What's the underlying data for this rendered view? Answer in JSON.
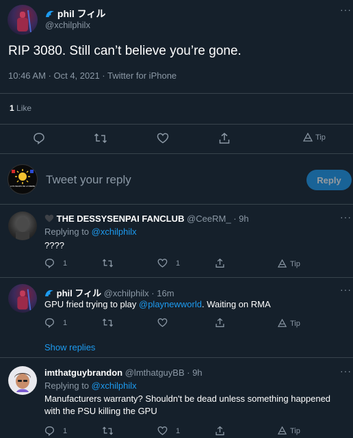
{
  "main_tweet": {
    "display_name": "phil フィル",
    "handle": "@xchilphilx",
    "text": "RIP 3080. Still can’t believe you’re gone.",
    "meta": "10:46 AM · Oct 4, 2021 · Twitter for iPhone",
    "likes_count": "1",
    "likes_label": "Like",
    "tip_label": "Tip"
  },
  "compose": {
    "placeholder": "Tweet your reply",
    "reply_button": "Reply",
    "avatar_text": "LOS DEADS DE LA MEME"
  },
  "replies": [
    {
      "display_name": "THE DESSYSENPAI FANCLUB",
      "handle": "@CeeRM_",
      "time": "· 9h",
      "replying_to_label": "Replying to",
      "replying_to": "@xchilphilx",
      "text": "????",
      "reply_count": "1",
      "like_count": "1",
      "tip_label": "Tip"
    },
    {
      "display_name": "phil フィル",
      "handle": "@xchilphilx",
      "time": "· 16m",
      "text_before": "GPU fried trying to play ",
      "text_mention": "@playnewworld",
      "text_after": ". Waiting on RMA",
      "reply_count": "1",
      "tip_label": "Tip",
      "show_replies": "Show replies"
    },
    {
      "display_name": "imthatguybrandon",
      "handle": "@lmthatguyBB",
      "time": "· 9h",
      "replying_to_label": "Replying to",
      "replying_to": "@xchilphilx",
      "text_line1": "Manufacturers warranty? Shouldn't be dead unless something happened",
      "text_line2": "with the PSU killing the GPU",
      "reply_count": "1",
      "like_count": "1",
      "tip_label": "Tip"
    }
  ],
  "colors": {
    "background": "#15202b",
    "accent": "#1d9bf0",
    "muted": "#8b98a5",
    "divider": "#38444d"
  }
}
